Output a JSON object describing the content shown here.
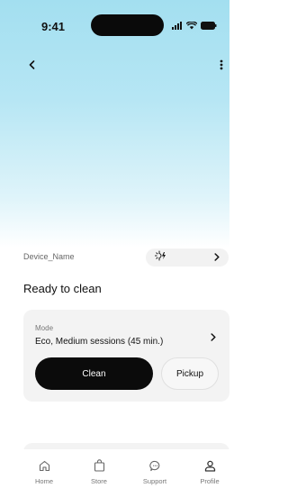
{
  "status_bar": {
    "time": "9:41"
  },
  "device": {
    "name": "Device_Name"
  },
  "status_message": "Ready to clean",
  "mode": {
    "label": "Mode",
    "value": "Eco, Medium sessions (45 min.)"
  },
  "actions": {
    "clean": "Clean",
    "pickup": "Pickup"
  },
  "tabs": [
    {
      "label": "Home",
      "icon": "home-icon"
    },
    {
      "label": "Store",
      "icon": "shopping-bag-icon"
    },
    {
      "label": "Support",
      "icon": "chat-bubble-icon"
    },
    {
      "label": "Profile",
      "icon": "user-icon"
    }
  ],
  "colors": {
    "hero_top": "#a3dff0",
    "primary_button": "#0b0b0b",
    "card_bg": "#f3f3f3"
  }
}
